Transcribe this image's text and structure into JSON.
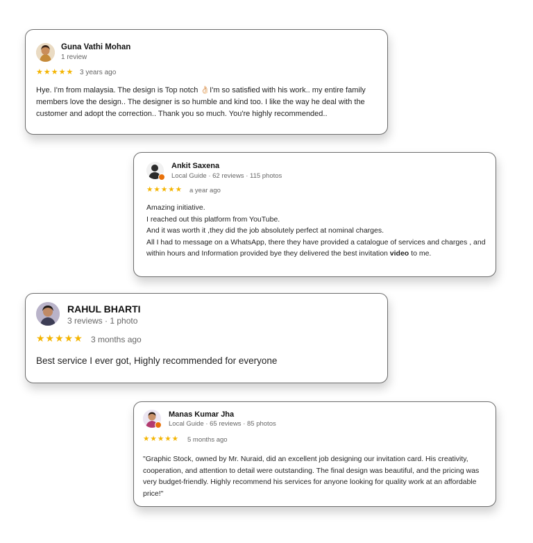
{
  "reviews": [
    {
      "name": "Guna Vathi Mohan",
      "meta": "1 review",
      "stars": "★★★★★",
      "ago": "3 years ago",
      "text": "Hye. I'm from malaysia. The design is Top notch 👌🏻I'm so satisfied with his work.. my entire family members love the design.. The designer is so humble and kind too. I like the way he deal with the customer and adopt the correction.. Thank you so much. You're highly recommended.."
    },
    {
      "name": "Ankit Saxena",
      "meta": "Local Guide · 62 reviews · 115 photos",
      "stars": "★★★★★",
      "ago": "a year ago",
      "lines": [
        "Amazing initiative.",
        "I reached out this platform from YouTube.",
        "And it was worth it ,they did the job absolutely perfect at nominal charges.",
        "All I had to message on a WhatsApp, there they have provided a catalogue of services and charges , and within hours and Information provided bye they delivered the best invitation"
      ],
      "bold_word": "video",
      "tail": " to me."
    },
    {
      "name": "RAHUL BHARTI",
      "meta": "3 reviews · 1 photo",
      "stars": "★★★★★",
      "ago": "3 months ago",
      "text": "Best service I ever got, Highly recommended for everyone"
    },
    {
      "name": "Manas Kumar Jha",
      "meta": "Local Guide · 65 reviews · 85 photos",
      "stars": "★★★★★",
      "ago": "5 months ago",
      "text": "\"Graphic Stock, owned by Mr. Nuraid, did an excellent job designing our invitation card. His creativity, cooperation, and attention to detail were outstanding. The final design was beautiful, and the pricing was very budget-friendly. Highly recommend his services for anyone looking for quality work at an affordable price!\""
    }
  ],
  "colors": {
    "star": "#f4b400",
    "badge": "#e8710a",
    "border": "#6b6b6b"
  }
}
